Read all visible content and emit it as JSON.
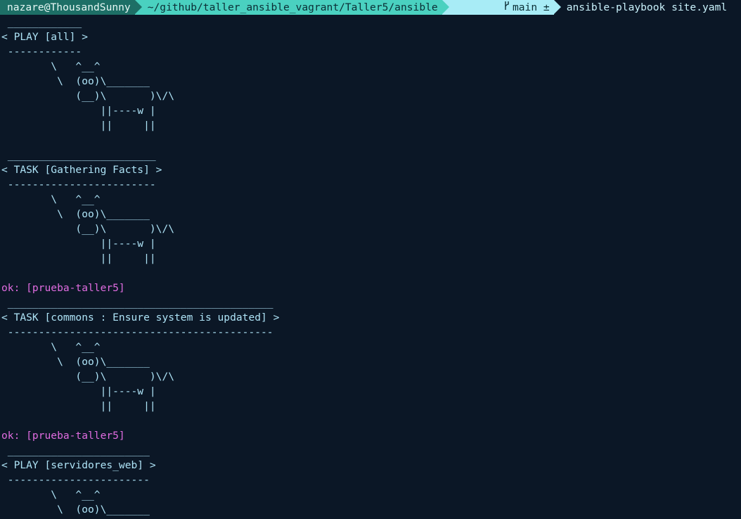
{
  "prompt": {
    "user_host": "nazare@ThousandSunny",
    "path": "~/github/taller_ansible_vagrant/Taller5/ansible",
    "branch_icon": "git-branch-icon",
    "branch": "main ±",
    "command": "ansible-playbook site.yaml"
  },
  "colors": {
    "background": "#0b1726",
    "cow_text": "#aee3f6",
    "ok_status": "#e06ce0",
    "segment_user": "#1d6f66",
    "segment_path": "#4ad1c0",
    "segment_git": "#a8ecf6"
  },
  "output_lines": [
    {
      "kind": "cow",
      "text": " ____________"
    },
    {
      "kind": "cow",
      "text": "< PLAY [all] >"
    },
    {
      "kind": "cow",
      "text": " ------------"
    },
    {
      "kind": "cow",
      "text": "        \\   ^__^"
    },
    {
      "kind": "cow",
      "text": "         \\  (oo)\\_______"
    },
    {
      "kind": "cow",
      "text": "            (__)\\       )\\/\\"
    },
    {
      "kind": "cow",
      "text": "                ||----w |"
    },
    {
      "kind": "cow",
      "text": "                ||     ||"
    },
    {
      "kind": "blank",
      "text": ""
    },
    {
      "kind": "cow",
      "text": " ________________________"
    },
    {
      "kind": "cow",
      "text": "< TASK [Gathering Facts] >"
    },
    {
      "kind": "cow",
      "text": " ------------------------"
    },
    {
      "kind": "cow",
      "text": "        \\   ^__^"
    },
    {
      "kind": "cow",
      "text": "         \\  (oo)\\_______"
    },
    {
      "kind": "cow",
      "text": "            (__)\\       )\\/\\"
    },
    {
      "kind": "cow",
      "text": "                ||----w |"
    },
    {
      "kind": "cow",
      "text": "                ||     ||"
    },
    {
      "kind": "blank",
      "text": ""
    },
    {
      "kind": "ok",
      "text": "ok: [prueba-taller5]"
    },
    {
      "kind": "cow",
      "text": " ___________________________________________"
    },
    {
      "kind": "cow",
      "text": "< TASK [commons : Ensure system is updated] >"
    },
    {
      "kind": "cow",
      "text": " -------------------------------------------"
    },
    {
      "kind": "cow",
      "text": "        \\   ^__^"
    },
    {
      "kind": "cow",
      "text": "         \\  (oo)\\_______"
    },
    {
      "kind": "cow",
      "text": "            (__)\\       )\\/\\"
    },
    {
      "kind": "cow",
      "text": "                ||----w |"
    },
    {
      "kind": "cow",
      "text": "                ||     ||"
    },
    {
      "kind": "blank",
      "text": ""
    },
    {
      "kind": "ok",
      "text": "ok: [prueba-taller5]"
    },
    {
      "kind": "cow",
      "text": " _______________________"
    },
    {
      "kind": "cow",
      "text": "< PLAY [servidores_web] >"
    },
    {
      "kind": "cow",
      "text": " -----------------------"
    },
    {
      "kind": "cow",
      "text": "        \\   ^__^"
    },
    {
      "kind": "cow",
      "text": "         \\  (oo)\\_______"
    }
  ]
}
